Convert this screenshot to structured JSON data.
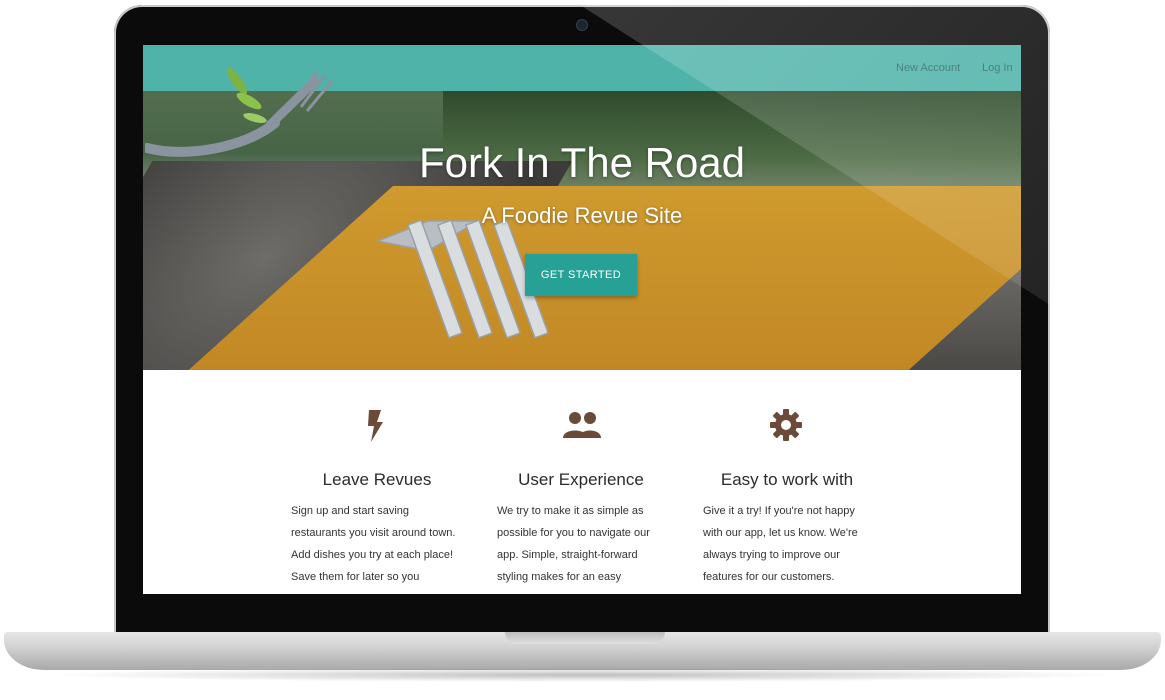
{
  "nav": {
    "new_account": "New Account",
    "log_in": "Log In"
  },
  "hero": {
    "title": "Fork In The Road",
    "subtitle": "A Foodie Revue Site",
    "cta_label": "GET STARTED"
  },
  "features": [
    {
      "icon": "lightning-icon",
      "title": "Leave Revues",
      "text": "Sign up and start saving restaurants you visit around town. Add dishes you try at each place! Save them for later so you"
    },
    {
      "icon": "users-icon",
      "title": "User Experience",
      "text": "We try to make it as simple as possible for you to navigate our app. Simple, straight-forward styling makes for an easy"
    },
    {
      "icon": "gear-icon",
      "title": "Easy to work with",
      "text": "Give it a try! If you're not happy with our app, let us know. We're always trying to improve our features for our customers."
    }
  ],
  "colors": {
    "navbar": "#4fb3a9",
    "cta": "#27a096",
    "icon_brown": "#6b4a3a",
    "nav_text": "#2f6e68"
  }
}
